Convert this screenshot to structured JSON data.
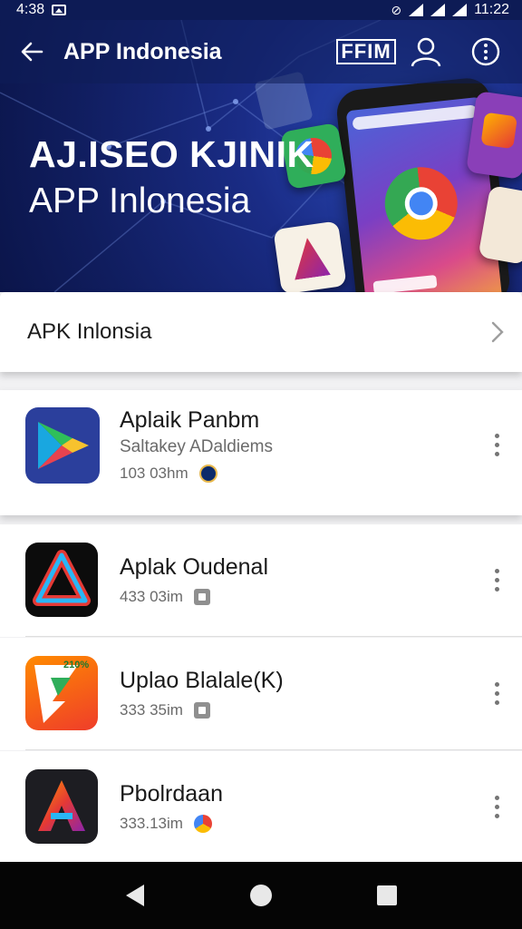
{
  "status_bar": {
    "time": "4:38",
    "clock": "11:22"
  },
  "app_bar": {
    "title": "APP Indonesia",
    "logo_text": "FFIM",
    "icons": [
      "back-arrow-icon",
      "account-icon",
      "more-circle-icon"
    ]
  },
  "hero": {
    "title": "AJ.ISEO KJINIK",
    "subtitle": "APP Inlonesia",
    "background_color": "#101d5e"
  },
  "section": {
    "title": "APK Inlonsia"
  },
  "apps": [
    {
      "name": "Aplaik Panbm",
      "developer": "Saltakey ADaldiems",
      "size": "103 03hm",
      "badge": "dark"
    },
    {
      "name": "Aplak Oudenal",
      "size": "433 03im",
      "badge": "gray"
    },
    {
      "name": "Uplao Blalale(K)",
      "size": "333 35im",
      "icon_text": "210%",
      "badge": "gray"
    },
    {
      "name": "Pbolrdaan",
      "size": "333.13im",
      "badge": "color"
    }
  ],
  "nav_bar": {
    "icons": [
      "nav-back-icon",
      "nav-home-icon",
      "nav-recent-icon"
    ]
  }
}
